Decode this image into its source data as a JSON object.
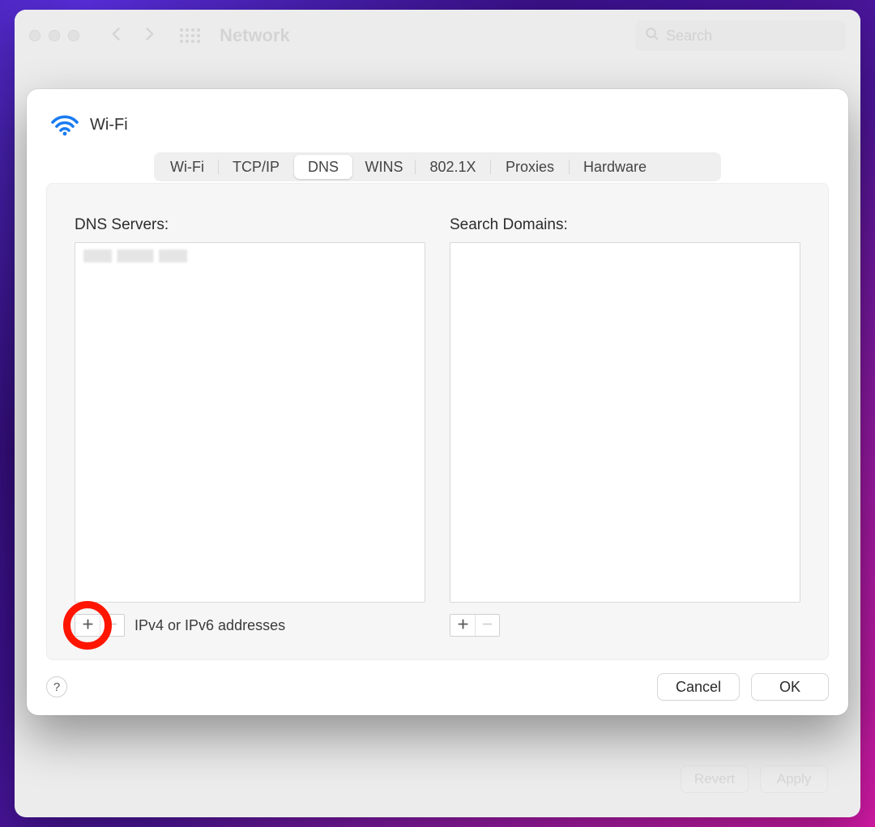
{
  "parent_window": {
    "title": "Network",
    "search_placeholder": "Search",
    "footer": {
      "revert_label": "Revert",
      "apply_label": "Apply"
    }
  },
  "sheet": {
    "interface_name": "Wi-Fi",
    "tabs": {
      "wifi": "Wi-Fi",
      "tcpip": "TCP/IP",
      "dns": "DNS",
      "wins": "WINS",
      "8021x": "802.1X",
      "proxies": "Proxies",
      "hardware": "Hardware"
    },
    "active_tab": "dns",
    "dns": {
      "servers_label": "DNS Servers:",
      "servers_hint": "IPv4 or IPv6 addresses",
      "search_domains_label": "Search Domains:"
    },
    "footer": {
      "help_label": "?",
      "cancel_label": "Cancel",
      "ok_label": "OK"
    }
  },
  "annotation": {
    "highlight_target": "dns-server-add-button"
  }
}
